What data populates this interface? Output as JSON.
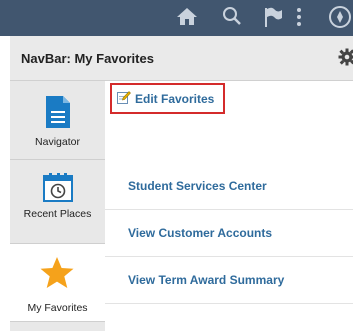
{
  "topbar": {
    "icons": [
      "home-icon",
      "search-icon",
      "flag-icon",
      "more-options-icon",
      "navbar-compass-icon"
    ]
  },
  "navbar": {
    "title": "NavBar: My Favorites",
    "settings_icon": "gear-icon"
  },
  "sidebar": {
    "items": [
      {
        "label": "Navigator",
        "icon": "navigator-icon"
      },
      {
        "label": "Recent Places",
        "icon": "recent-places-icon"
      },
      {
        "label": "My Favorites",
        "icon": "star-icon",
        "active": true
      }
    ]
  },
  "favorites": {
    "edit_label": "Edit Favorites",
    "edit_icon": "edit-icon",
    "items": [
      {
        "label": "Student Services Center"
      },
      {
        "label": "View Customer Accounts"
      },
      {
        "label": "View Term Award Summary"
      }
    ]
  },
  "colors": {
    "topbar": "#41566f",
    "link": "#2f6b9c",
    "highlight_border": "#d42b2b",
    "star": "#f5a21b",
    "navigator_icon": "#1a7bc4"
  }
}
